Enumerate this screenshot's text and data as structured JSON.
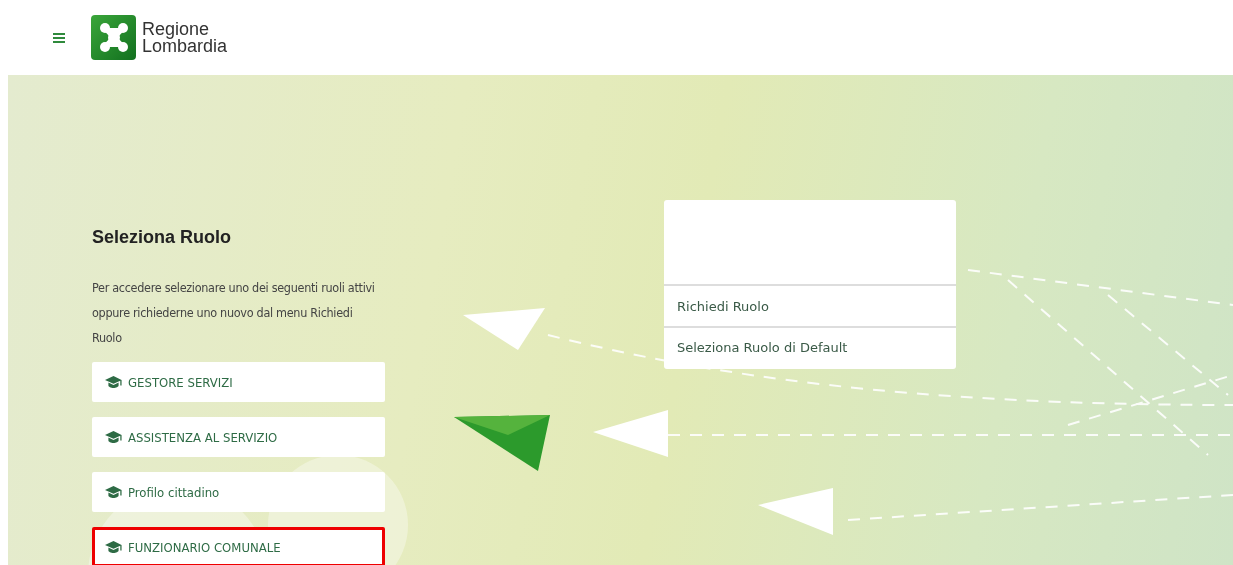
{
  "header": {
    "brand_line_1": "Regione",
    "brand_line_2": "Lombardia"
  },
  "role_panel": {
    "title": "Seleziona Ruolo",
    "description": "Per accedere selezionare uno dei seguenti ruoli attivi oppure richiederne uno nuovo dal menu Richiedi Ruolo",
    "roles": [
      {
        "label": "GESTORE SERVIZI",
        "highlighted": false
      },
      {
        "label": "ASSISTENZA AL SERVIZIO",
        "highlighted": false
      },
      {
        "label": "Profilo cittadino",
        "highlighted": false
      },
      {
        "label": "FUNZIONARIO COMUNALE",
        "highlighted": true
      }
    ]
  },
  "menu_card": {
    "items": [
      {
        "label": "Richiedi Ruolo"
      },
      {
        "label": "Seleziona Ruolo di Default"
      }
    ]
  }
}
